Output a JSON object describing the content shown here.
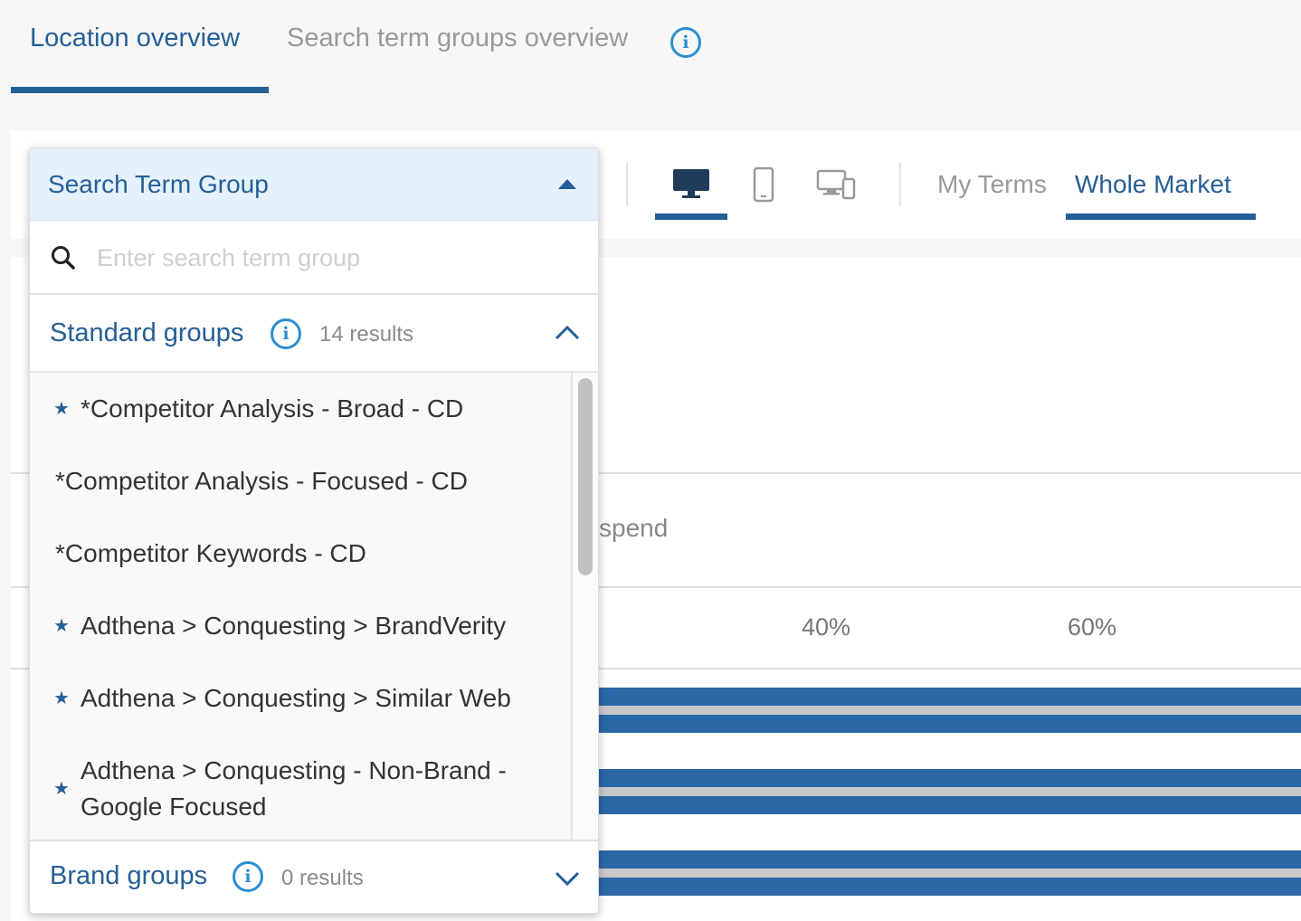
{
  "tabs": {
    "location_overview": "Location overview",
    "search_term_groups_overview": "Search term groups overview"
  },
  "toolbar": {
    "devices": [
      "desktop-icon",
      "mobile-icon",
      "all-devices-icon"
    ],
    "active_device": "desktop",
    "my_terms": "My Terms",
    "whole_market": "Whole Market"
  },
  "background": {
    "metric_label_fragment": "spend",
    "axis_ticks": [
      "40%",
      "60%"
    ]
  },
  "dropdown": {
    "title": "Search Term Group",
    "search_placeholder": "Enter search term group",
    "standard_groups": {
      "title": "Standard groups",
      "count": "14 results",
      "items": [
        {
          "label": "*Competitor Analysis - Broad - CD",
          "starred": true
        },
        {
          "label": "*Competitor Analysis - Focused - CD",
          "starred": false
        },
        {
          "label": "*Competitor Keywords - CD",
          "starred": false
        },
        {
          "label": "Adthena > Conquesting > BrandVerity",
          "starred": true
        },
        {
          "label": "Adthena > Conquesting > Similar Web",
          "starred": true
        },
        {
          "label_line1": "Adthena > Conquesting - Non-Brand -",
          "label_line2": "Google Focused",
          "starred": true
        }
      ]
    },
    "brand_groups": {
      "title": "Brand groups",
      "count": "0 results"
    }
  },
  "colors": {
    "accent": "#255f97",
    "info": "#2a8fd0",
    "bar": "#2c67a6",
    "header_bg": "#e5f1fc"
  }
}
